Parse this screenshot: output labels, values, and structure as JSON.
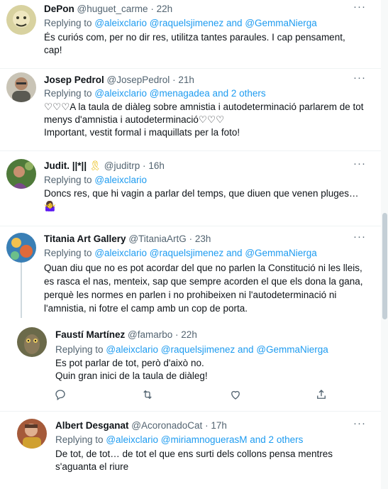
{
  "tweets": [
    {
      "name": "DePon",
      "handle": "@huguet_carme",
      "time": "22h",
      "reply_prefix": "Replying to",
      "mentions": "@aleixclario @raquelsjimenez and @GemmaNierga",
      "lines": [
        "És curiós com, per no dir res, utilitza tantes paraules. I cap pensament,",
        "cap!"
      ]
    },
    {
      "name": "Josep Pedrol",
      "handle": "@JosepPedrol",
      "time": "21h",
      "reply_prefix": "Replying to",
      "mentions": "@aleixclario @menagadea and 2 others",
      "lines": [
        "♡♡♡A la taula de diàleg sobre amnistia i autodeterminació parlarem de tot",
        "menys d'amnistia i autodeterminació♡♡♡",
        "Important, vestit formal i maquillats per la foto!"
      ]
    },
    {
      "name": "Judit. ||*||",
      "emoji": "🎗",
      "handle": "@juditrp",
      "time": "16h",
      "reply_prefix": "Replying to",
      "mentions": "@aleixclario",
      "lines": [
        "Doncs res, que hi vagin a parlar del temps, que diuen que venen pluges…"
      ],
      "trailing_emoji": "🤷‍♀️"
    },
    {
      "name": "Titania Art Gallery",
      "handle": "@TitaniaArtG",
      "time": "23h",
      "reply_prefix": "Replying to",
      "mentions": "@aleixclario @raquelsjimenez and @GemmaNierga",
      "lines": [
        "Quan diu que no es pot acordar del que no parlen la Constitució ni les lleis,",
        "es rasca el nas, menteix, sap que sempre acorden el que els dona la gana,",
        "perquè les normes en parlen i no prohibeixen ni l'autodeterminació ni",
        "l'amnistia, ni fotre el camp amb un cop de porta."
      ]
    },
    {
      "name": "Faustí Martínez",
      "handle": "@famarbo",
      "time": "22h",
      "reply_prefix": "Replying to",
      "mentions": "@aleixclario @raquelsjimenez and @GemmaNierga",
      "lines": [
        "Es pot parlar de tot, però d'això no.",
        "Quin gran inici de la taula de diàleg!"
      ]
    },
    {
      "name": "Albert Desganat",
      "handle": "@AcoronadoCat",
      "time": "17h",
      "reply_prefix": "Replying to",
      "mentions": "@aleixclario @miriamnoguerasM and 2 others",
      "lines": [
        "De tot, de tot… de tot el que ens surti dels collons pensa mentres",
        "s'aguanta  el riure"
      ]
    }
  ],
  "dot": "·",
  "more_glyph": "···",
  "icons": [
    "reply-icon",
    "retweet-icon",
    "like-icon",
    "share-icon",
    "more-icon"
  ],
  "colors": {
    "link": "#1d9bf0",
    "secondary": "#536471",
    "text": "#0f1419",
    "border": "#eff3f4"
  }
}
